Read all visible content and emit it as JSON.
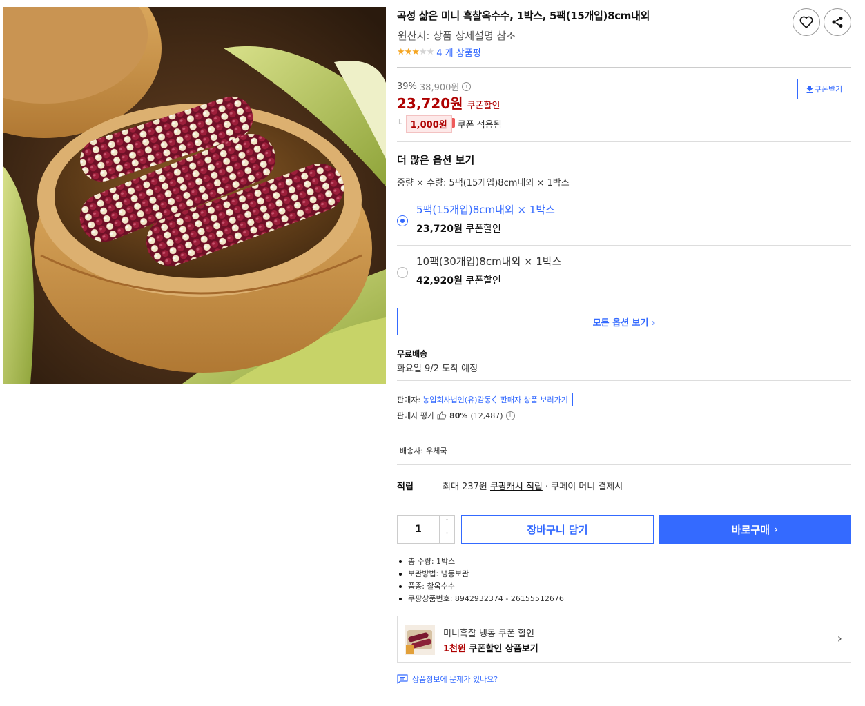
{
  "product": {
    "title": "곡성 삶은 미니 흑찰옥수수, 1박스, 5팩(15개입)8cm내외",
    "origin": "원산지: 상품 상세설명 참조",
    "rating": 3,
    "review_link": "4 개 상품평"
  },
  "actions": {
    "wishlist_icon": "heart-icon",
    "share_icon": "share-icon"
  },
  "price": {
    "discount_rate": "39%",
    "original_price": "38,900원",
    "info_icon": "i",
    "sale_price": "23,720원",
    "sale_label": "쿠폰할인",
    "tree_mark": "└",
    "coupon_amount": "1,000원",
    "coupon_applied_text": "쿠폰 적용됨",
    "coupon_button": "쿠폰받기"
  },
  "options": {
    "section_title": "더 많은 옵션 보기",
    "subtitle": "중량 × 수량: 5팩(15개입)8cm내외 × 1박스",
    "items": [
      {
        "name": "5팩(15개입)8cm내외 × 1박스",
        "price": "23,720원",
        "price_label": "쿠폰할인",
        "selected": true
      },
      {
        "name": "10팩(30개입)8cm내외 × 1박스",
        "price": "42,920원",
        "price_label": "쿠폰할인",
        "selected": false
      }
    ],
    "view_all_button": "모든 옵션 보기 ›"
  },
  "shipping": {
    "title": "무료배송",
    "arrival": "화요일 9/2 도착 예정"
  },
  "seller": {
    "label": "판매자:",
    "name": "농업회사법인(유)감동",
    "page_button": "판매자 상품 보러가기",
    "rating_label": "판매자 평가",
    "rating_percent": "80%",
    "rating_count": "(12,487)"
  },
  "carrier": {
    "label": "배송사:",
    "name": "우체국"
  },
  "reward": {
    "label": "적립",
    "prefix": "최대 237원",
    "link": "쿠팡캐시 적립",
    "suffix": "· 쿠페이 머니 결제시"
  },
  "purchase": {
    "quantity": "1",
    "qty_up": "˄",
    "qty_down": "˅",
    "cart_button": "장바구니 담기",
    "buy_button": "바로구매",
    "buy_chevron": "›"
  },
  "details": [
    "총 수량: 1박스",
    "보관방법: 냉동보관",
    "품종: 찰옥수수",
    "쿠팡상품번호: 8942932374 - 26155512676"
  ],
  "promo": {
    "line1": "미니흑찰  냉동 쿠폰 할인",
    "highlight": "1천원",
    "line2_rest": " 쿠폰할인 상품보기",
    "chevron": "›"
  },
  "report_link": "상품정보에 문제가 있나요?",
  "colors": {
    "accent": "#346aff",
    "price_red": "#ae0000",
    "star": "#f5a623"
  }
}
